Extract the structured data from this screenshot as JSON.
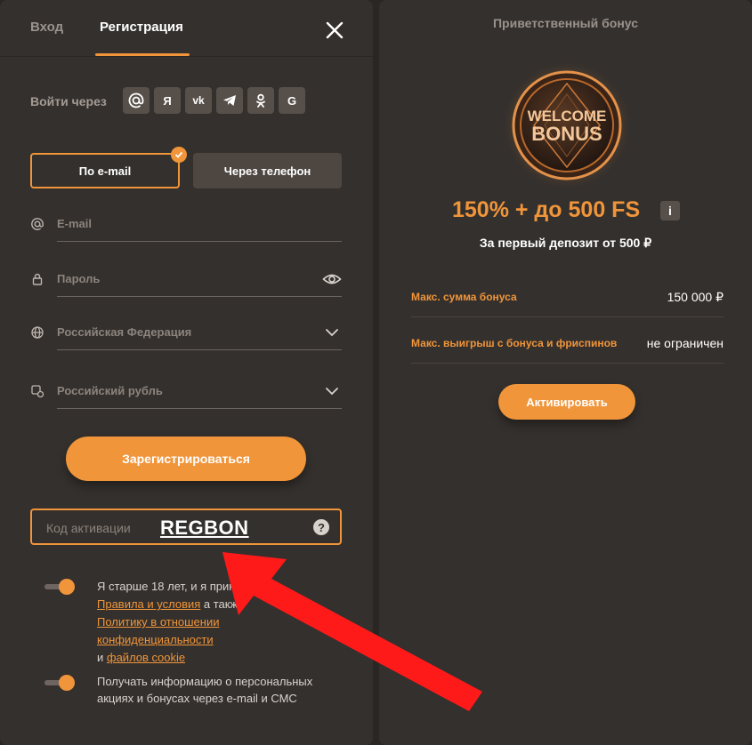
{
  "tabs": {
    "login": "Вход",
    "register": "Регистрация"
  },
  "social": {
    "label": "Войти через",
    "items": [
      {
        "name": "mail",
        "glyph": "@"
      },
      {
        "name": "yandex",
        "glyph": "Я"
      },
      {
        "name": "vk",
        "glyph": "vk"
      },
      {
        "name": "telegram",
        "glyph": ""
      },
      {
        "name": "odnoklassniki",
        "glyph": ""
      },
      {
        "name": "google",
        "glyph": "G"
      }
    ]
  },
  "mode": {
    "email": "По e-mail",
    "phone": "Через телефон"
  },
  "fields": {
    "email": {
      "placeholder": "E-mail"
    },
    "password": {
      "placeholder": "Пароль"
    },
    "country": {
      "value": "Российская Федерация"
    },
    "currency": {
      "value": "Российский рубль"
    }
  },
  "register_button": "Зарегистрироваться",
  "promo": {
    "placeholder": "Код активации",
    "code": "REGBON",
    "help": "?"
  },
  "consent": {
    "age_text_1": "Я старше 18 лет, и я приним",
    "terms_link": "Правила и условия",
    "also": " а также",
    "privacy_link_1": "Политику в отношении",
    "privacy_link_2": "конфиденциальности",
    "and": "и ",
    "cookie_link": "файлов cookie",
    "promo_line_1": "Получать информацию о персональных",
    "promo_line_2": "акциях и бонусах через e-mail и СМС"
  },
  "bonus": {
    "title": "Приветственный бонус",
    "coin_line_1": "WELCOME",
    "coin_line_2": "BONUS",
    "headline": "150% + до 500 FS",
    "info": "i",
    "subtitle": "За первый депозит от 500 ₽",
    "rows": [
      {
        "key": "Макс. сумма бонуса",
        "value": "150 000 ₽"
      },
      {
        "key": "Макс. выигрыш с бонуса и фриспинов",
        "value": "не ограничен"
      }
    ],
    "activate": "Активировать"
  },
  "colors": {
    "accent": "#f0953a",
    "panel": "#34302d",
    "background": "#2a2624",
    "annotation": "#ff1a1a"
  }
}
